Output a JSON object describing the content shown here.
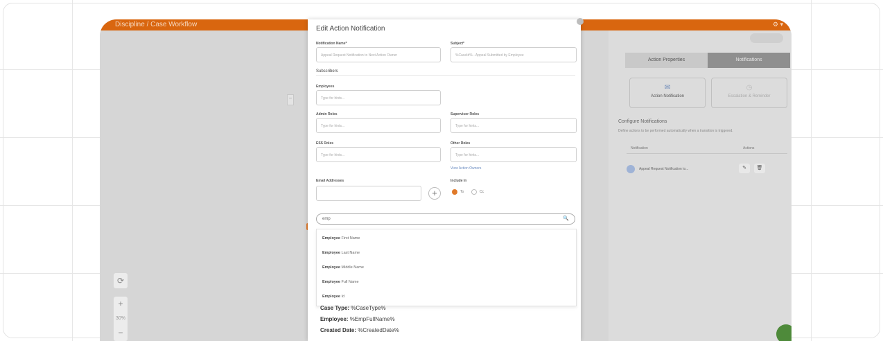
{
  "colors": {
    "accent": "#d9660f",
    "panel_tab_active": "#8f8f8f",
    "link": "#6a8bc0"
  },
  "topbar": {
    "breadcrumb": "Discipline / Case Workflow"
  },
  "canvas": {
    "zoom": "30%"
  },
  "panel": {
    "tabs": [
      "Action Properties",
      "Notifications"
    ],
    "cards": [
      "Action Notification",
      "Escalation & Reminder"
    ],
    "configure_title": "Configure Notifications",
    "configure_desc": "Define actions to be performed automatically when a transition is triggered.",
    "table_headers": [
      "Notification",
      "Actions"
    ],
    "row_name": "Appeal Request Notification to..."
  },
  "modal": {
    "title": "Edit Action Notification",
    "labels": {
      "notification_name": "Notification Name*",
      "subject": "Subject*",
      "subscribers": "Subscribers",
      "employees": "Employees",
      "admin_roles": "Admin Roles",
      "supervisor_roles": "Supervisor Roles",
      "ess_roles": "ESS Roles",
      "other_roles": "Other Roles",
      "email_addresses": "Email Addresses",
      "include_in": "Include In"
    },
    "values": {
      "notification_name": "Appeal Request Notification to Next Action Owner",
      "subject": "%CaseId% - Appeal Submitted by Employee"
    },
    "placeholder": "Type for hints...",
    "more_link": "View Action Owners",
    "radio_to": "To",
    "radio_cc": "Cc",
    "search_value": "emp",
    "dropdown": [
      {
        "bold": "Employee",
        "rest": " First Name"
      },
      {
        "bold": "Employee",
        "rest": " Last Name"
      },
      {
        "bold": "Employee",
        "rest": " Middle Name"
      },
      {
        "bold": "Employee",
        "rest": " Full Name"
      },
      {
        "bold": "Employee",
        "rest": " Id"
      }
    ],
    "editor": [
      {
        "label": "Case Type:",
        "value": " %CaseType%"
      },
      {
        "label": "Employee:",
        "value": " %EmpFullName%"
      },
      {
        "label": "Created Date:",
        "value": " %CreatedDate%"
      }
    ]
  }
}
